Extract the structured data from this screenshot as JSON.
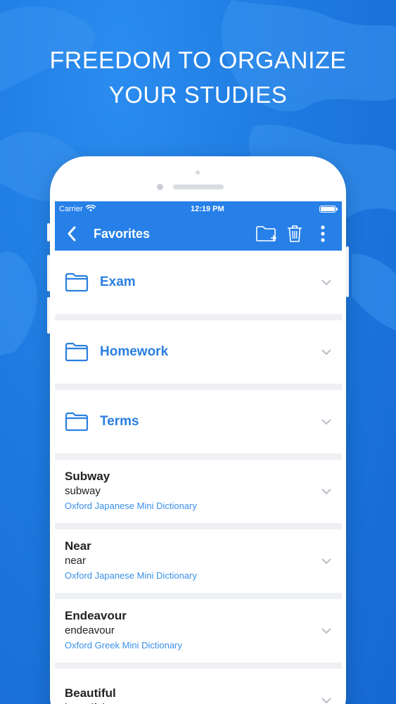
{
  "headline": {
    "line1": "FREEDOM TO ORGANIZE",
    "line2": "YOUR STUDIES"
  },
  "status": {
    "carrier": "Carrier",
    "time": "12:19 PM",
    "wifi_icon": "wifi-icon",
    "battery_icon": "battery-icon",
    "battery_level": 1.0
  },
  "navbar": {
    "title": "Favorites",
    "back_icon": "chevron-left-icon",
    "actions": [
      "new-folder-icon",
      "trash-icon",
      "more-vertical-icon"
    ]
  },
  "folders": [
    {
      "name": "Exam"
    },
    {
      "name": "Homework"
    },
    {
      "name": "Terms"
    }
  ],
  "words": [
    {
      "headword": "Subway",
      "translation": "subway",
      "source": "Oxford Japanese Mini Dictionary"
    },
    {
      "headword": "Near",
      "translation": "near",
      "source": "Oxford Japanese Mini Dictionary"
    },
    {
      "headword": "Endeavour",
      "translation": "endeavour",
      "source": "Oxford Greek Mini Dictionary"
    },
    {
      "headword": "Beautiful",
      "translation": "beautiful",
      "source": ""
    }
  ],
  "colors": {
    "background": "#1f7fe0",
    "bar": "#2680e8",
    "accent": "#2a7fe0",
    "source_link": "#3a90e8"
  }
}
